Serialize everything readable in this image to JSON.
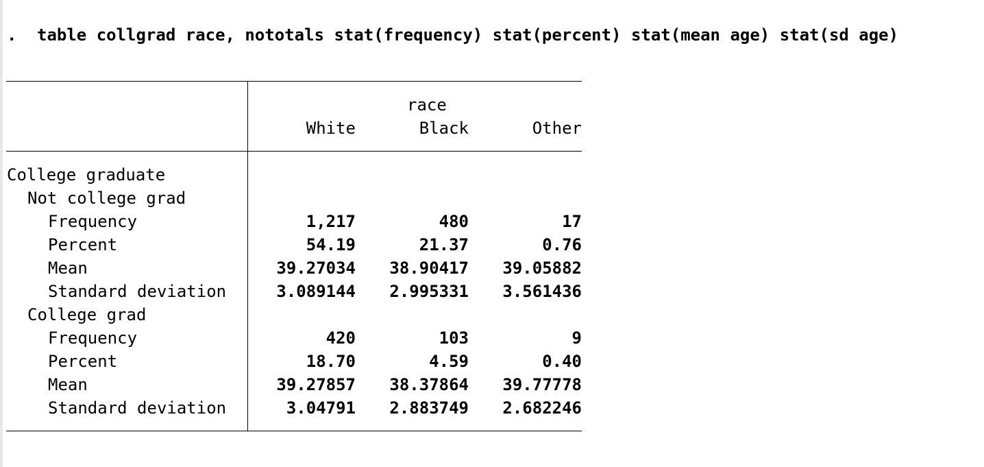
{
  "command": {
    "prompt": ".",
    "text": "table collgrad race, nototals stat(frequency) stat(percent) stat(mean age) stat(sd age)"
  },
  "table": {
    "column_var": "race",
    "columns": [
      "White",
      "Black",
      "Other"
    ],
    "row_var": "College graduate",
    "groups": [
      {
        "label": "Not college grad",
        "stats": [
          {
            "label": "Frequency",
            "values": [
              "1,217",
              "480",
              "17"
            ]
          },
          {
            "label": "Percent",
            "values": [
              "54.19",
              "21.37",
              "0.76"
            ]
          },
          {
            "label": "Mean",
            "values": [
              "39.27034",
              "38.90417",
              "39.05882"
            ]
          },
          {
            "label": "Standard deviation",
            "values": [
              "3.089144",
              "2.995331",
              "3.561436"
            ]
          }
        ]
      },
      {
        "label": "College grad",
        "stats": [
          {
            "label": "Frequency",
            "values": [
              "420",
              "103",
              "9"
            ]
          },
          {
            "label": "Percent",
            "values": [
              "18.70",
              "4.59",
              "0.40"
            ]
          },
          {
            "label": "Mean",
            "values": [
              "39.27857",
              "38.37864",
              "39.77778"
            ]
          },
          {
            "label": "Standard deviation",
            "values": [
              "3.04791",
              "2.883749",
              "2.682246"
            ]
          }
        ]
      }
    ]
  }
}
